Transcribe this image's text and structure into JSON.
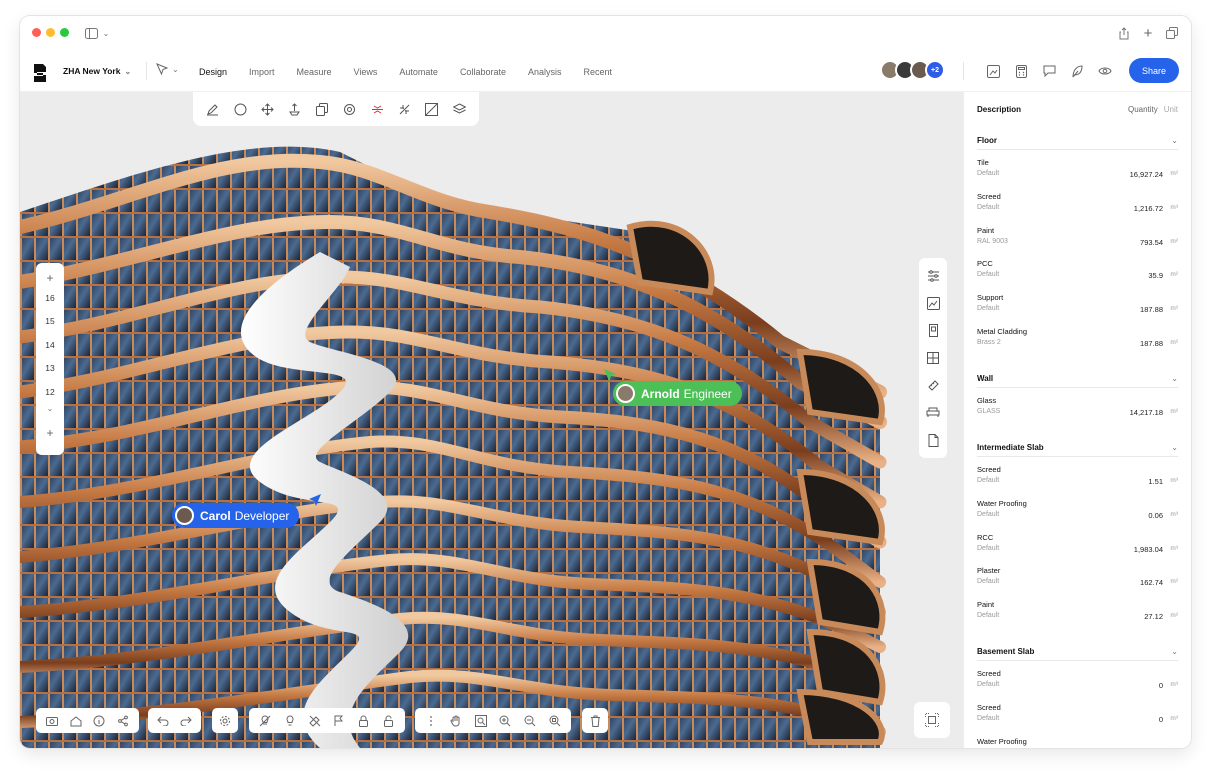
{
  "project": {
    "name": "ZHA New York"
  },
  "nav": {
    "tabs": [
      "Design",
      "Import",
      "Measure",
      "Views",
      "Automate",
      "Collaborate",
      "Analysis",
      "Recent"
    ],
    "active_tab": "Design",
    "avatars_more": "+2",
    "share_label": "Share"
  },
  "colors": {
    "accent": "#2563eb",
    "arnold": "#4cbf57",
    "carol": "#2563eb"
  },
  "floors": {
    "levels": [
      "16",
      "15",
      "14",
      "13",
      "12"
    ],
    "add": "+"
  },
  "collaborators": {
    "arnold": {
      "first": "Arnold",
      "role": "Engineer"
    },
    "carol": {
      "first": "Carol",
      "role": "Developer"
    }
  },
  "panel": {
    "header": {
      "description": "Description",
      "quantity": "Quantity",
      "unit": "Unit"
    },
    "sections": [
      {
        "title": "Floor",
        "items": [
          {
            "name": "Tile",
            "sub": "Default",
            "value": "16,927.24",
            "unit": "m²"
          },
          {
            "name": "Screed",
            "sub": "Default",
            "value": "1,216.72",
            "unit": "m³"
          },
          {
            "name": "Paint",
            "sub": "RAL 9003",
            "value": "793.54",
            "unit": "m²"
          },
          {
            "name": "PCC",
            "sub": "Default",
            "value": "35.9",
            "unit": "m²"
          },
          {
            "name": "Support",
            "sub": "Default",
            "value": "187.88",
            "unit": "m²"
          },
          {
            "name": "Metal Cladding",
            "sub": "Brass 2",
            "value": "187.88",
            "unit": "m²"
          }
        ]
      },
      {
        "title": "Wall",
        "items": [
          {
            "name": "Glass",
            "sub": "GLASS",
            "value": "14,217.18",
            "unit": "m²"
          }
        ]
      },
      {
        "title": "Intermediate Slab",
        "items": [
          {
            "name": "Screed",
            "sub": "Default",
            "value": "1.51",
            "unit": "m³"
          },
          {
            "name": "Water Proofing",
            "sub": "Default",
            "value": "0.06",
            "unit": "m³"
          },
          {
            "name": "RCC",
            "sub": "Default",
            "value": "1,983.04",
            "unit": "m³"
          },
          {
            "name": "Plaster",
            "sub": "Default",
            "value": "162.74",
            "unit": "m²"
          },
          {
            "name": "Paint",
            "sub": "Default",
            "value": "27.12",
            "unit": "m²"
          }
        ]
      },
      {
        "title": "Basement Slab",
        "items": [
          {
            "name": "Screed",
            "sub": "Default",
            "value": "0",
            "unit": "m³"
          },
          {
            "name": "Screed",
            "sub": "Default",
            "value": "0",
            "unit": "m³"
          },
          {
            "name": "Water Proofing",
            "sub": "",
            "value": "",
            "unit": ""
          }
        ]
      }
    ]
  }
}
